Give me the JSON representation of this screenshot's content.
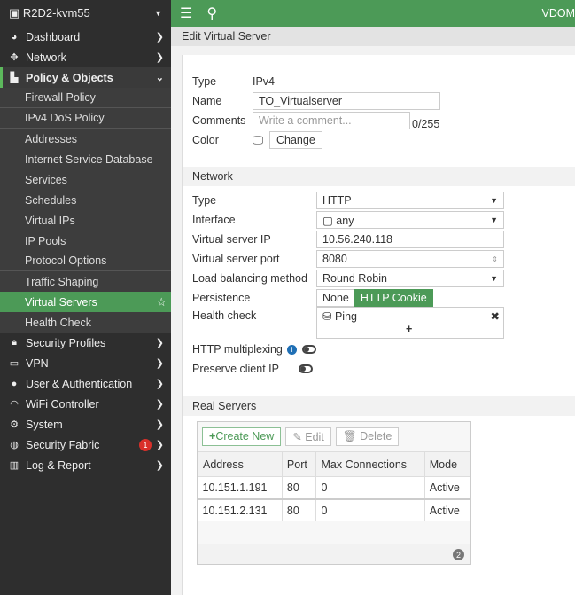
{
  "sidebar": {
    "device": "R2D2-kvm55",
    "top": [
      {
        "label": "Dashboard",
        "icon": "dashboard-icon"
      },
      {
        "label": "Network",
        "icon": "network-icon"
      }
    ],
    "open": "Policy & Objects",
    "sub": [
      "Firewall Policy",
      "IPv4 DoS Policy",
      "Addresses",
      "Internet Service Database",
      "Services",
      "Schedules",
      "Virtual IPs",
      "IP Pools",
      "Protocol Options",
      "Traffic Shaping",
      "Virtual Servers",
      "Health Check"
    ],
    "bottom": [
      {
        "label": "Security Profiles"
      },
      {
        "label": "VPN"
      },
      {
        "label": "User & Authentication"
      },
      {
        "label": "WiFi Controller"
      },
      {
        "label": "System"
      },
      {
        "label": "Security Fabric",
        "badge": "1"
      },
      {
        "label": "Log & Report"
      }
    ]
  },
  "topbar": {
    "vdom": "VDOM"
  },
  "header": {
    "title": "Edit Virtual Server"
  },
  "form": {
    "type_label": "Type",
    "type_value": "IPv4",
    "name_label": "Name",
    "name_value": "TO_Virtualserver",
    "comments_label": "Comments",
    "comments_placeholder": "Write a comment...",
    "comments_count": "0/255",
    "color_label": "Color",
    "change_label": "Change"
  },
  "network": {
    "title": "Network",
    "type_label": "Type",
    "type_value": "HTTP",
    "interface_label": "Interface",
    "interface_value": "any",
    "ip_label": "Virtual server IP",
    "ip_value": "10.56.240.118",
    "port_label": "Virtual server port",
    "port_value": "8080",
    "lb_label": "Load balancing method",
    "lb_value": "Round Robin",
    "persist_label": "Persistence",
    "persist_options": [
      "None",
      "HTTP Cookie"
    ],
    "health_label": "Health check",
    "health_value": "Ping",
    "mux_label": "HTTP multiplexing",
    "preserve_label": "Preserve client IP"
  },
  "real_servers": {
    "title": "Real Servers",
    "create": "Create New",
    "edit": "Edit",
    "delete": "Delete",
    "columns": [
      "Address",
      "Port",
      "Max Connections",
      "Mode"
    ],
    "rows": [
      [
        "10.151.1.191",
        "80",
        "0",
        "Active"
      ],
      [
        "10.151.2.131",
        "80",
        "0",
        "Active"
      ]
    ],
    "count": "2"
  },
  "colors": {
    "accent": "#4c9a57"
  }
}
